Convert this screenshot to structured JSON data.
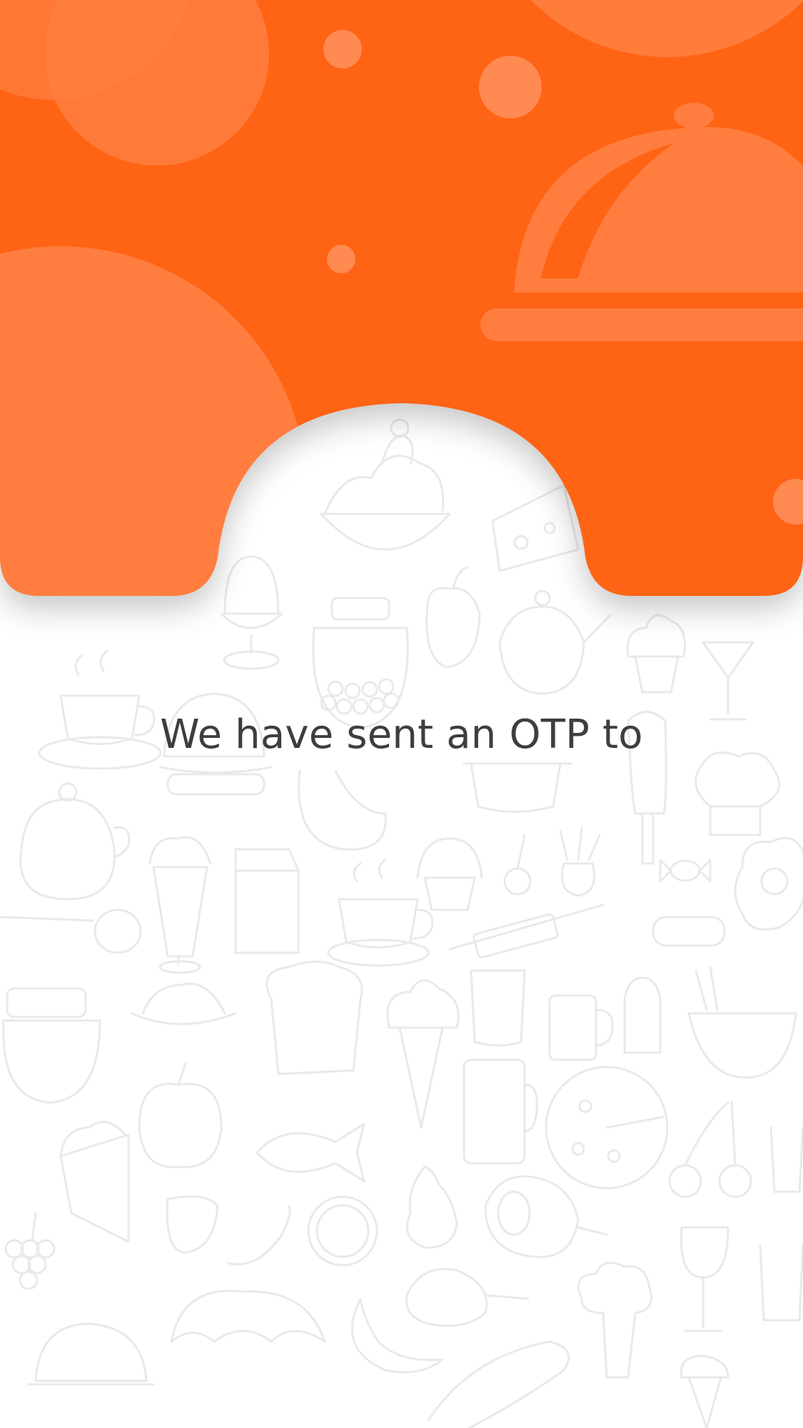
{
  "screen": {
    "title": "We have sent an OTP to"
  },
  "theme": {
    "accent": "#FF6314",
    "accent_light": "#FF7E3F",
    "doodle_stroke": "#E9E9E9",
    "background": "#FFFFFF",
    "text": "#3E3E3E"
  },
  "header": {
    "illustration_icon": "serving-cloche-icon",
    "background_pattern_icon": "food-doodle-pattern"
  }
}
